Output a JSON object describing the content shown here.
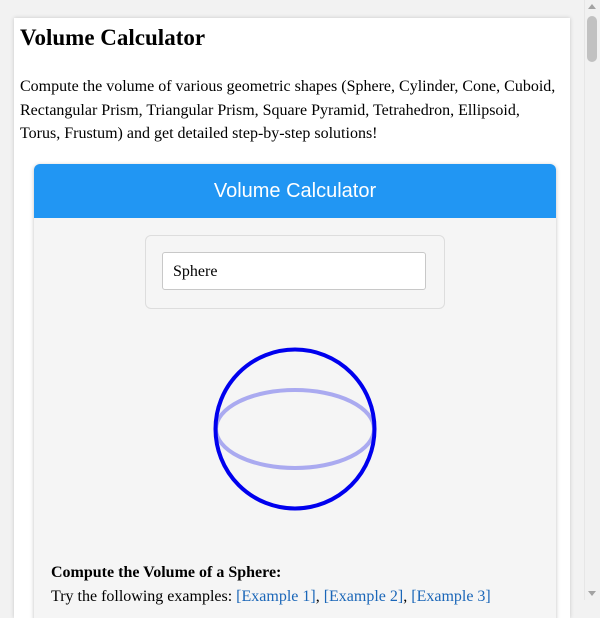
{
  "page": {
    "title": "Volume Calculator",
    "intro": "Compute the volume of various geometric shapes (Sphere, Cylinder, Cone, Cuboid, Rectangular Prism, Triangular Prism, Square Pyramid, Tetrahedron, Ellipsoid, Torus, Frustum) and get detailed step-by-step solutions!"
  },
  "calculator": {
    "header": "Volume Calculator",
    "shape_select": {
      "selected": "Sphere"
    },
    "figure": {
      "shape": "sphere",
      "outline_color": "#0000ee",
      "equator_color": "#aaaaf0"
    },
    "section_heading": "Compute the Volume of a Sphere:",
    "examples": {
      "prefix": "Try the following examples:",
      "links": [
        "[Example 1]",
        "[Example 2]",
        "[Example 3]"
      ],
      "separator": ","
    }
  },
  "colors": {
    "accent": "#2196f3",
    "link": "#1a66b8"
  }
}
